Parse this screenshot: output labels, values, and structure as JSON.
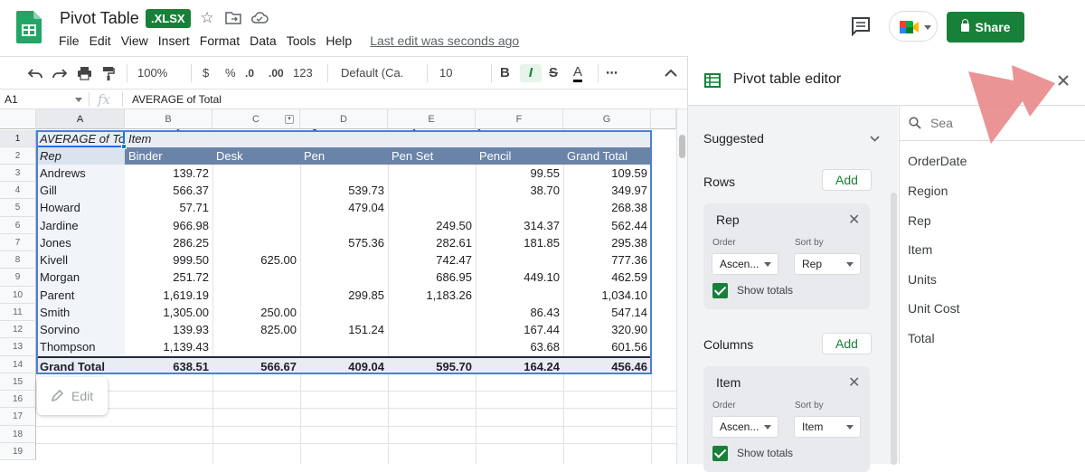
{
  "header": {
    "title": "Pivot Table",
    "badge": ".XLSX",
    "menu": [
      "File",
      "Edit",
      "View",
      "Insert",
      "Format",
      "Data",
      "Tools",
      "Help"
    ],
    "last_edit": "Last edit was seconds ago",
    "share_label": "Share"
  },
  "toolbar": {
    "zoom": "100%",
    "currency": "$",
    "percent": "%",
    "dec_decrease": ".0",
    "dec_increase": ".00",
    "more_formats": "123",
    "font": "Default (Ca...",
    "font_size": "10",
    "bold": "B",
    "italic": "I",
    "strike": "S",
    "text_color": "A",
    "more": "⋯"
  },
  "formula_bar": {
    "cell_ref": "A1",
    "fx": "fx",
    "value": "AVERAGE of Total"
  },
  "grid": {
    "columns": [
      "A",
      "B",
      "C",
      "D",
      "E",
      "F",
      "G"
    ],
    "row_numbers": [
      "1",
      "2",
      "3",
      "4",
      "5",
      "6",
      "7",
      "8",
      "9",
      "10",
      "11",
      "12",
      "13",
      "14",
      "15",
      "16",
      "17",
      "18",
      "19"
    ],
    "r1": {
      "a": "AVERAGE of Total",
      "b": "Item"
    },
    "header": [
      "Rep",
      "Binder",
      "Desk",
      "Pen",
      "Pen Set",
      "Pencil",
      "Grand Total"
    ],
    "rows": [
      [
        "Andrews",
        "139.72",
        "",
        "",
        "",
        "99.55",
        "109.59"
      ],
      [
        "Gill",
        "566.37",
        "",
        "539.73",
        "",
        "38.70",
        "349.97"
      ],
      [
        "Howard",
        "57.71",
        "",
        "479.04",
        "",
        "",
        "268.38"
      ],
      [
        "Jardine",
        "966.98",
        "",
        "",
        "249.50",
        "314.37",
        "562.44"
      ],
      [
        "Jones",
        "286.25",
        "",
        "575.36",
        "282.61",
        "181.85",
        "295.38"
      ],
      [
        "Kivell",
        "999.50",
        "625.00",
        "",
        "742.47",
        "",
        "777.36"
      ],
      [
        "Morgan",
        "251.72",
        "",
        "",
        "686.95",
        "449.10",
        "462.59"
      ],
      [
        "Parent",
        "1,619.19",
        "",
        "299.85",
        "1,183.26",
        "",
        "1,034.10"
      ],
      [
        "Smith",
        "1,305.00",
        "250.00",
        "",
        "",
        "86.43",
        "547.14"
      ],
      [
        "Sorvino",
        "139.93",
        "825.00",
        "151.24",
        "",
        "167.44",
        "320.90"
      ],
      [
        "Thompson",
        "1,139.43",
        "",
        "",
        "",
        "63.68",
        "601.56"
      ]
    ],
    "grand_total": [
      "Grand Total",
      "638.51",
      "566.67",
      "409.04",
      "595.70",
      "164.24",
      "456.46"
    ]
  },
  "edit_button": "Edit",
  "panel": {
    "title": "Pivot table editor",
    "suggested": "Suggested",
    "rows_label": "Rows",
    "columns_label": "Columns",
    "add_label": "Add",
    "search_placeholder": "Sea",
    "rows_card": {
      "name": "Rep",
      "order_label": "Order",
      "order_value": "Ascen...",
      "sortby_label": "Sort by",
      "sortby_value": "Rep",
      "show_totals": "Show totals"
    },
    "columns_card": {
      "name": "Item",
      "order_label": "Order",
      "order_value": "Ascen...",
      "sortby_label": "Sort by",
      "sortby_value": "Item",
      "show_totals": "Show totals"
    },
    "fields": [
      "OrderDate",
      "Region",
      "Rep",
      "Item",
      "Units",
      "Unit Cost",
      "Total"
    ]
  },
  "colors": {
    "brand_green": "#188038",
    "pivot_header_bg": "#6a84a8",
    "pivot_row_bg": "#e8edf4",
    "selection_blue": "#1a73e8",
    "arrow": "#e8888a"
  }
}
